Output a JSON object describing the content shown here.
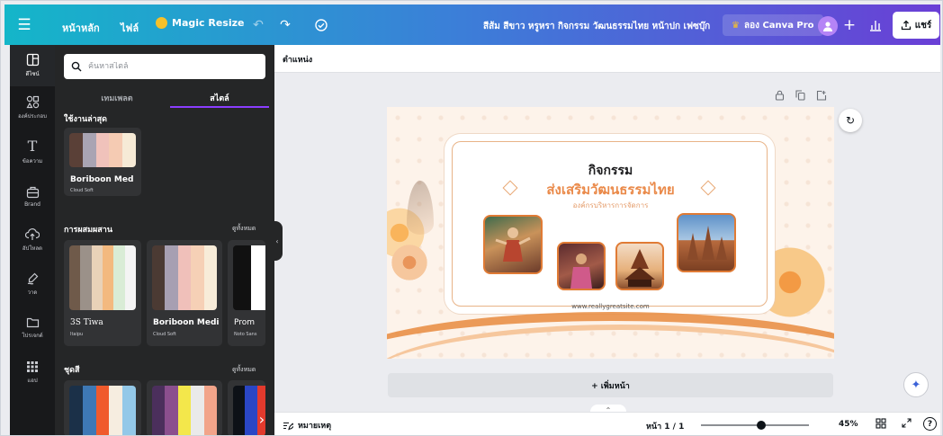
{
  "topbar": {
    "home": "หน้าหลัก",
    "file": "ไฟล์",
    "magic_resize": "Magic Resize",
    "doc_title": "สีส้ม สีขาว หรูหรา กิจกรรม วัฒนธรรมไทย หน้าปก เฟซบุ๊ก",
    "try_pro": "ลอง Canva Pro",
    "share": "แชร์"
  },
  "rail": {
    "items": [
      {
        "label": "ดีไซน์",
        "icon": "layout-icon"
      },
      {
        "label": "องค์ประกอบ",
        "icon": "shapes-icon"
      },
      {
        "label": "ข้อความ",
        "icon": "text-icon"
      },
      {
        "label": "Brand",
        "icon": "brand-icon"
      },
      {
        "label": "อัปโหลด",
        "icon": "upload-icon"
      },
      {
        "label": "วาด",
        "icon": "draw-icon"
      },
      {
        "label": "โปรเจกต์",
        "icon": "folder-icon"
      },
      {
        "label": "แอป",
        "icon": "apps-icon"
      }
    ]
  },
  "panel": {
    "search_placeholder": "ค้นหาสไตล์",
    "tabs": [
      "เทมเพลต",
      "สไตล์"
    ],
    "recent_title": "ใช้งานล่าสุด",
    "combos_title": "การผสมผสาน",
    "palettes_title": "ชุดสี",
    "see_all": "ดูทั้งหมด",
    "recent": [
      {
        "name": "Boriboon Med",
        "sub": "Cloud Soft",
        "colors": [
          "#5a4037",
          "#a9a4b3",
          "#f0c2bb",
          "#f5cbb3",
          "#f6ead6"
        ]
      }
    ],
    "combos": [
      {
        "name": "3S Tiwa",
        "sub": "Itaipu",
        "colors": [
          "#6f5a4a",
          "#9b9189",
          "#e9d2b8",
          "#f3b97f",
          "#d9ecd6",
          "#f4f4f4"
        ]
      },
      {
        "name": "Boriboon Medi",
        "sub": "Cloud Soft",
        "colors": [
          "#4b3a33",
          "#a79fb2",
          "#f0c0ba",
          "#f6d0b6",
          "#f8ecd9"
        ]
      },
      {
        "name": "Prom",
        "sub": "Noto Sans",
        "colors": [
          "#111111",
          "#ffffff"
        ]
      }
    ],
    "palettes": [
      {
        "colors": [
          "#1b3048",
          "#3e78b5",
          "#f05a2c",
          "#f6ede0",
          "#93c8e8"
        ]
      },
      {
        "colors": [
          "#4b2f5c",
          "#8b4f8e",
          "#f3e74b",
          "#eaeaea",
          "#f2a48a"
        ]
      },
      {
        "colors": [
          "#0d1117",
          "#2a46c5",
          "#e33a2d"
        ]
      }
    ]
  },
  "editor": {
    "position": "ตำแหน่ง",
    "add_page": "+ เพิ่มหน้า",
    "notes": "หมายเหตุ",
    "page_count": "หน้า 1 / 1",
    "zoom": "45%",
    "zoom_fraction": 0.45
  },
  "design": {
    "heading": "กิจกรรม",
    "title": "ส่งเสริมวัฒนธรรมไทย",
    "subtitle": "องค์กรบริหารการจัดการ",
    "url": "www.reallygreatsite.com"
  }
}
